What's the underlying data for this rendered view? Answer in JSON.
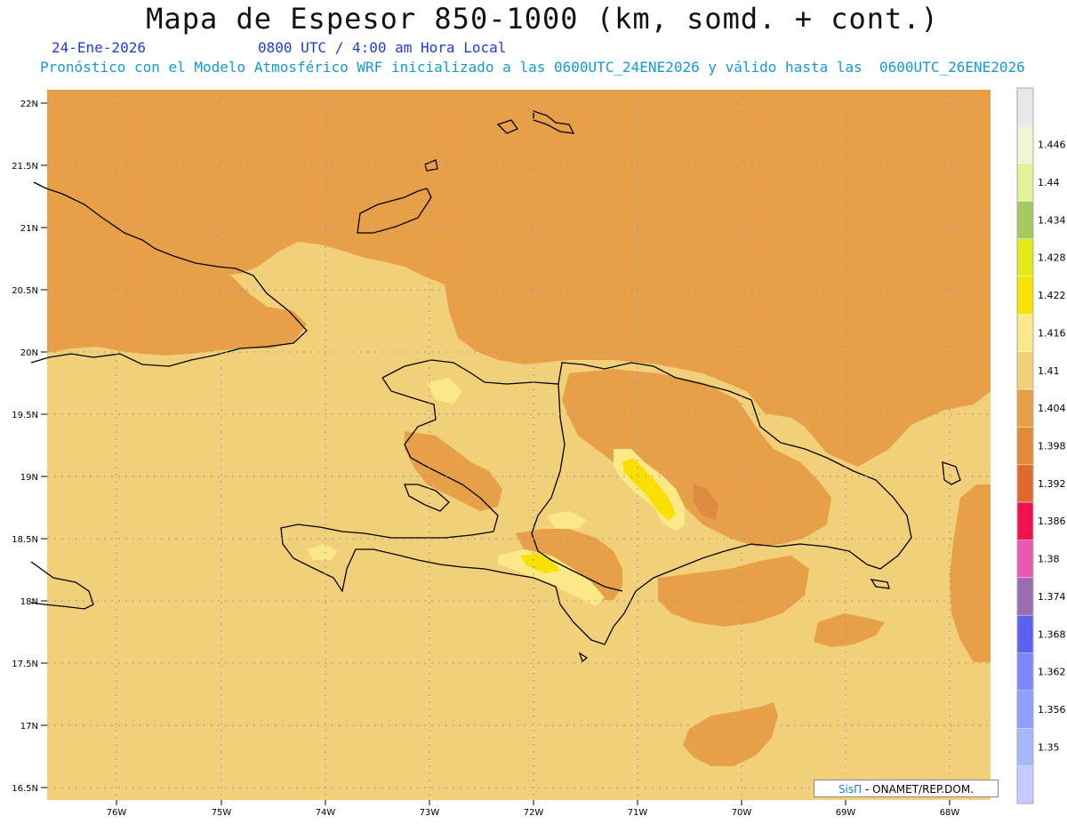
{
  "header": {
    "title": "Mapa de Espesor 850-1000 (km, somd. + cont.)",
    "date": "24-Ene-2026",
    "time": "0800 UTC / 4:00 am Hora Local",
    "description": "Pronóstico con el Modelo Atmosférico WRF inicializado a las 0600UTC_24ENE2026 y válido hasta las  0600UTC_26ENE2026"
  },
  "axes": {
    "lat_labels": [
      "22N",
      "21.5N",
      "21N",
      "20.5N",
      "20N",
      "19.5N",
      "19N",
      "18.5N",
      "18N",
      "17.5N",
      "17N",
      "16.5N"
    ],
    "lon_labels": [
      "76W",
      "75W",
      "74W",
      "73W",
      "72W",
      "71W",
      "70W",
      "69W",
      "68W"
    ]
  },
  "colorbar": {
    "levels": [
      "1.35",
      "1.356",
      "1.362",
      "1.368",
      "1.374",
      "1.38",
      "1.386",
      "1.392",
      "1.398",
      "1.404",
      "1.41",
      "1.416",
      "1.422",
      "1.428",
      "1.434",
      "1.44",
      "1.446"
    ],
    "colors": [
      "#c4ccff",
      "#a8b8ff",
      "#8ca0ff",
      "#7a88ff",
      "#6060f0",
      "#9a6cb0",
      "#e858b0",
      "#f01050",
      "#de6a30",
      "#e28a3a",
      "#e8a048",
      "#f2d07a",
      "#fbe888",
      "#fae000",
      "#e0ea18",
      "#a6c860",
      "#e2f298",
      "#eef6d0",
      "#e8e8e8"
    ]
  },
  "map": {
    "ocean_color": "#e8a048",
    "land_color": "#f2d07a",
    "high_color": "#fbe888",
    "peak_color": "#fae000",
    "low_color": "#de8a40"
  },
  "credit": {
    "logo": "SisΠ",
    "text": "- ONAMET/REP.DOM."
  }
}
